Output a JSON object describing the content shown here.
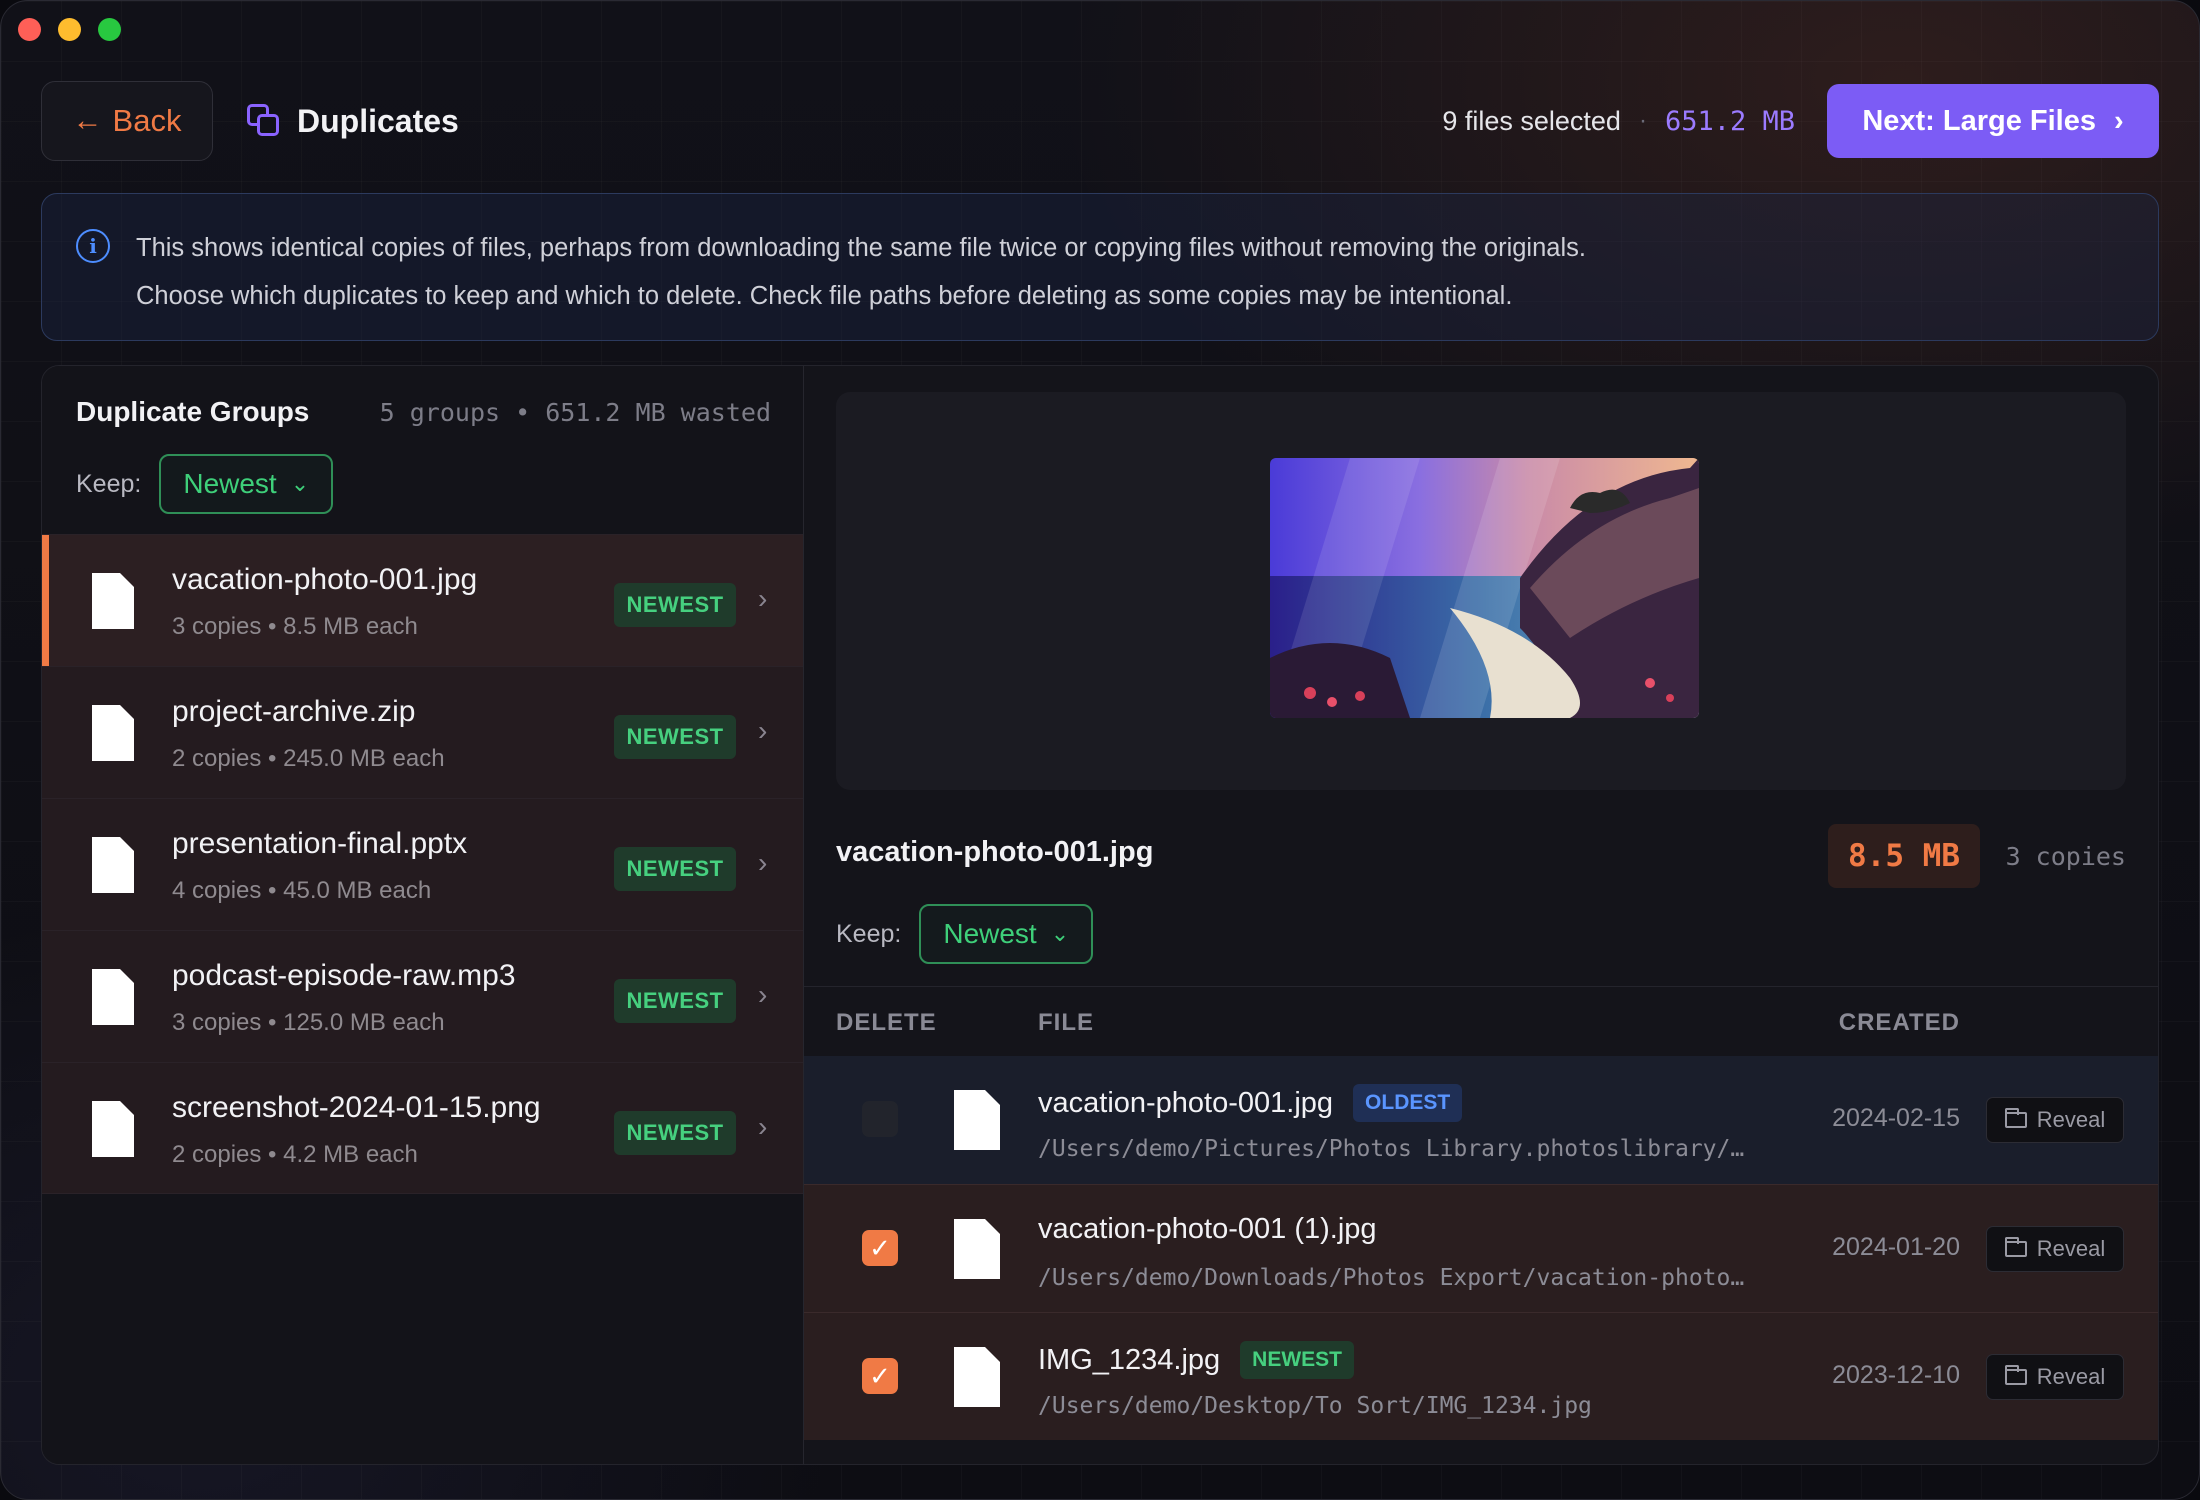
{
  "topbar": {
    "back_label": "Back",
    "title": "Duplicates",
    "selected_count": "9 files selected",
    "selected_size": "651.2 MB",
    "next_label": "Next: Large Files"
  },
  "info": {
    "line1": "This shows identical copies of files, perhaps from downloading the same file twice or copying files without removing the originals.",
    "line2": "Choose which duplicates to keep and which to delete. Check file paths before deleting as some copies may be intentional."
  },
  "groups_panel": {
    "title": "Duplicate Groups",
    "meta": "5 groups • 651.2 MB wasted",
    "keep_label": "Keep:",
    "keep_value": "Newest",
    "groups": [
      {
        "name": "vacation-photo-001.jpg",
        "meta": "3 copies • 8.5 MB each",
        "badge": "NEWEST"
      },
      {
        "name": "project-archive.zip",
        "meta": "2 copies • 245.0 MB each",
        "badge": "NEWEST"
      },
      {
        "name": "presentation-final.pptx",
        "meta": "4 copies • 45.0 MB each",
        "badge": "NEWEST"
      },
      {
        "name": "podcast-episode-raw.mp3",
        "meta": "3 copies • 125.0 MB each",
        "badge": "NEWEST"
      },
      {
        "name": "screenshot-2024-01-15.png",
        "meta": "2 copies • 4.2 MB each",
        "badge": "NEWEST"
      }
    ]
  },
  "detail": {
    "name": "vacation-photo-001.jpg",
    "size": "8.5 MB",
    "copies": "3 copies",
    "keep_label": "Keep:",
    "keep_value": "Newest",
    "columns": {
      "delete": "DELETE",
      "file": "FILE",
      "created": "CREATED"
    },
    "rows": [
      {
        "checked": false,
        "name": "vacation-photo-001.jpg",
        "tag": "OLDEST",
        "path": "/Users/demo/Pictures/Photos Library.photoslibrary/…",
        "date": "2024-02-15",
        "action": "Reveal"
      },
      {
        "checked": true,
        "name": "vacation-photo-001 (1).jpg",
        "tag": "",
        "path": "/Users/demo/Downloads/Photos Export/vacation-photo…",
        "date": "2024-01-20",
        "action": "Reveal"
      },
      {
        "checked": true,
        "name": "IMG_1234.jpg",
        "tag": "NEWEST",
        "path": "/Users/demo/Desktop/To Sort/IMG_1234.jpg",
        "date": "2023-12-10",
        "action": "Reveal"
      }
    ]
  },
  "colors": {
    "accent": "#f07a45",
    "primary": "#7c5cf5",
    "keep_green": "#3ed07a",
    "info_blue": "#4d8dff"
  },
  "icons": [
    "arrow-left-icon",
    "duplicate-icon",
    "chevron-right-icon",
    "info-icon",
    "chevron-down-icon",
    "file-icon",
    "check-icon",
    "folder-icon"
  ]
}
